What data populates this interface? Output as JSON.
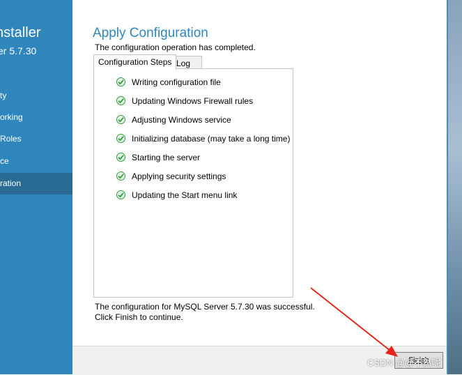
{
  "sidebar": {
    "title": "nstaller",
    "subtitle": "er 5.7.30",
    "items": [
      {
        "label": "ty"
      },
      {
        "label": "orking"
      },
      {
        "label": "Roles"
      },
      {
        "label": "ce"
      },
      {
        "label": "ration",
        "active": true
      }
    ]
  },
  "main": {
    "title": "Apply Configuration",
    "subtitle": "The configuration operation has completed.",
    "tabs": [
      {
        "label": "Configuration Steps",
        "active": true
      },
      {
        "label": "Log",
        "active": false
      }
    ],
    "steps": [
      {
        "label": "Writing configuration file",
        "status": "done"
      },
      {
        "label": "Updating Windows Firewall rules",
        "status": "done"
      },
      {
        "label": "Adjusting Windows service",
        "status": "done"
      },
      {
        "label": "Initializing database (may take a long time)",
        "status": "done"
      },
      {
        "label": "Starting the server",
        "status": "done"
      },
      {
        "label": "Applying security settings",
        "status": "done"
      },
      {
        "label": "Updating the Start menu link",
        "status": "done"
      }
    ],
    "result_line1": "The configuration for MySQL Server 5.7.30 was successful.",
    "result_line2": "Click Finish to continue."
  },
  "footer": {
    "finish_label": "Finish"
  },
  "watermark": "CSDN @@不然呢",
  "colors": {
    "sidebar": "#2f86bd",
    "sidebar_active": "#2a6b96",
    "accent": "#2f86bd",
    "check": "#2e9e3e",
    "arrow": "#e8231c"
  }
}
